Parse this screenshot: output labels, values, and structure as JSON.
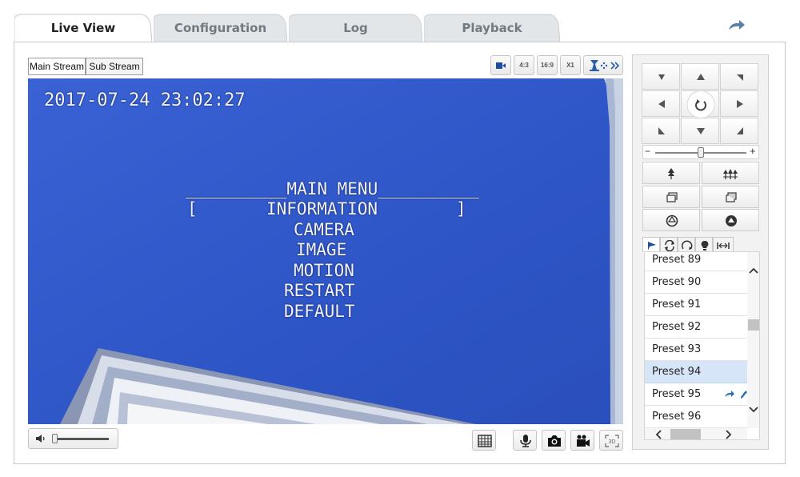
{
  "tabs": [
    {
      "label": "Live View",
      "active": true
    },
    {
      "label": "Configuration",
      "active": false
    },
    {
      "label": "Log",
      "active": false
    },
    {
      "label": "Playback",
      "active": false
    }
  ],
  "stream": {
    "main_label": "Main Stream",
    "sub_label": "Sub Stream",
    "selected": "Main Stream"
  },
  "toolbar": {
    "window_icon": "video-window-icon",
    "aspect_4_3": "4:3",
    "aspect_16_9": "16:9",
    "scale_x1": "X1",
    "ptz_icon": "ptz-expand-icon"
  },
  "osd": {
    "timestamp": "2017-07-24 23:02:27",
    "menu_title": "__________MAIN MENU__________",
    "menu_open_bracket": "[",
    "menu_close_bracket": "]",
    "menu_items": [
      "INFORMATION",
      "CAMERA",
      "IMAGE",
      "MOTION",
      "RESTART",
      "DEFAULT"
    ]
  },
  "audio": {
    "volume_icon": "speaker-icon",
    "volume_level": 0.0
  },
  "bottom_tools": [
    "ptz-grid-icon",
    "microphone-icon",
    "camera-icon",
    "video-camera-icon",
    "3d-zoom-icon"
  ],
  "ptz": {
    "zoom_level": 0.5,
    "zoom_minus": "−",
    "zoom_plus": "+",
    "preset_tabs": [
      "preset-icon",
      "patrol-icon",
      "pattern-icon",
      "light-icon",
      "one-touch-icon"
    ],
    "presets": [
      {
        "label": "Preset 89",
        "selected": false
      },
      {
        "label": "Preset 90",
        "selected": false
      },
      {
        "label": "Preset 91",
        "selected": false
      },
      {
        "label": "Preset 92",
        "selected": false
      },
      {
        "label": "Preset 93",
        "selected": false
      },
      {
        "label": "Preset 94",
        "selected": true
      },
      {
        "label": "Preset 95",
        "selected": false
      },
      {
        "label": "Preset 96",
        "selected": false
      }
    ]
  },
  "colors": {
    "video_bg": "#2f56c8",
    "accent": "#2c6fb8",
    "selected_row": "#d6e6f8"
  }
}
